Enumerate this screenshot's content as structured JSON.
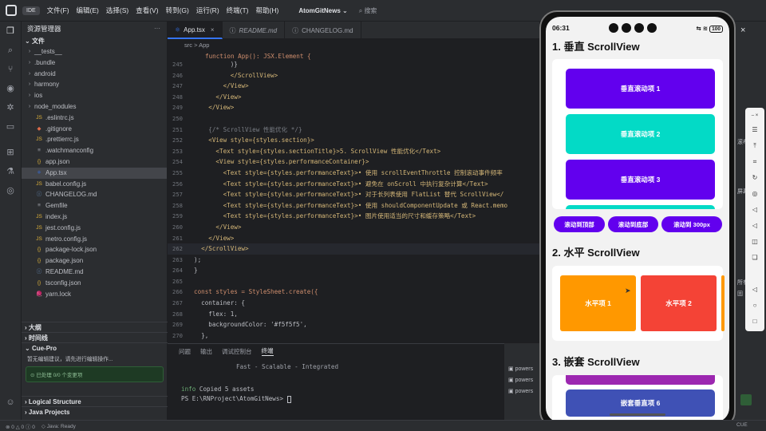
{
  "titlebar": {
    "logo_badge": "IDE",
    "menu": [
      "文件(F)",
      "编辑(E)",
      "选择(S)",
      "查看(V)",
      "转到(G)",
      "运行(R)",
      "终端(T)",
      "帮助(H)"
    ],
    "project": "AtomGitNews",
    "search_placeholder": "搜索"
  },
  "explorer": {
    "title": "资源管理器",
    "root": "文件",
    "items": [
      {
        "name": "__tests__",
        "type": "folder"
      },
      {
        "name": ".bundle",
        "type": "folder"
      },
      {
        "name": "android",
        "type": "folder"
      },
      {
        "name": "harmony",
        "type": "folder"
      },
      {
        "name": "ios",
        "type": "folder"
      },
      {
        "name": "node_modules",
        "type": "folder"
      },
      {
        "name": ".eslintrc.js",
        "type": "file"
      },
      {
        "name": ".gitignore",
        "type": "file"
      },
      {
        "name": ".prettierrc.js",
        "type": "file"
      },
      {
        "name": ".watchmanconfig",
        "type": "file"
      },
      {
        "name": "app.json",
        "type": "file"
      },
      {
        "name": "App.tsx",
        "type": "file"
      },
      {
        "name": "babel.config.js",
        "type": "file"
      },
      {
        "name": "CHANGELOG.md",
        "type": "file"
      },
      {
        "name": "Gemfile",
        "type": "file"
      },
      {
        "name": "index.js",
        "type": "file"
      },
      {
        "name": "jest.config.js",
        "type": "file"
      },
      {
        "name": "metro.config.js",
        "type": "file"
      },
      {
        "name": "package-lock.json",
        "type": "file"
      },
      {
        "name": "package.json",
        "type": "file"
      },
      {
        "name": "README.md",
        "type": "file"
      },
      {
        "name": "tsconfig.json",
        "type": "file"
      },
      {
        "name": "yarn.lock",
        "type": "file"
      }
    ],
    "outline": "大纲",
    "timeline": "时间线",
    "cue_title": "Cue-Pro",
    "cue_text": "暂无编辑建议，请先进行编辑操作...",
    "cue_status": "已处理 0/0 个变更项",
    "logical_structure": "Logical Structure",
    "java_projects": "Java Projects"
  },
  "editor": {
    "tabs": [
      "App.tsx",
      "README.md",
      "CHANGELOG.md"
    ],
    "breadcrumb": "src  >  App",
    "first_line": "function App(): JSX.Element {",
    "lines": [
      {
        "n": "245",
        "t": "          )}"
      },
      {
        "n": "246",
        "t": "          </ScrollView>"
      },
      {
        "n": "247",
        "t": "        </View>"
      },
      {
        "n": "248",
        "t": "      </View>"
      },
      {
        "n": "249",
        "t": "    </View>"
      },
      {
        "n": "250",
        "t": ""
      },
      {
        "n": "251",
        "t": "    {/* ScrollView 性能优化 */}"
      },
      {
        "n": "252",
        "t": "    <View style={styles.section}>"
      },
      {
        "n": "253",
        "t": "      <Text style={styles.sectionTitle}>5. ScrollView 性能优化</Text>"
      },
      {
        "n": "254",
        "t": "      <View style={styles.performanceContainer}>"
      },
      {
        "n": "255",
        "t": "        <Text style={styles.performanceText}>• 使用 scrollEventThrottle 控制滚动事件频率"
      },
      {
        "n": "256",
        "t": "        <Text style={styles.performanceText}>• 避免在 onScroll 中执行复杂计算</Text>"
      },
      {
        "n": "257",
        "t": "        <Text style={styles.performanceText}>• 对于长列表使用 FlatList 替代 ScrollView</"
      },
      {
        "n": "258",
        "t": "        <Text style={styles.performanceText}>• 使用 shouldComponentUpdate 或 React.memo"
      },
      {
        "n": "259",
        "t": "        <Text style={styles.performanceText}>• 图片使用适当的尺寸和缓存策略</Text>"
      },
      {
        "n": "260",
        "t": "      </View>"
      },
      {
        "n": "261",
        "t": "    </View>"
      },
      {
        "n": "262",
        "t": "  </ScrollView>"
      },
      {
        "n": "263",
        "t": ");"
      },
      {
        "n": "264",
        "t": "}"
      },
      {
        "n": "265",
        "t": ""
      },
      {
        "n": "266",
        "t": "const styles = StyleSheet.create({"
      },
      {
        "n": "267",
        "t": "  container: {"
      },
      {
        "n": "268",
        "t": "    flex: 1,"
      },
      {
        "n": "269",
        "t": "    backgroundColor: '#f5f5f5',"
      },
      {
        "n": "270",
        "t": "  },"
      }
    ]
  },
  "panel": {
    "tabs": [
      "问题",
      "输出",
      "调试控制台",
      "终端"
    ],
    "line1": "Fast - Scalable - Integrated",
    "line2_prefix": "info",
    "line2": " Copied 5 assets",
    "prompt": "PS E:\\RNProject\\AtomGitNews> ",
    "side_items": [
      "powers",
      "powers",
      "powers"
    ]
  },
  "status": {
    "errors": "0",
    "warnings": "0",
    "info": "0",
    "java": "Java: Ready",
    "right": "CUE"
  },
  "phone": {
    "time": "06:31",
    "battery": "100",
    "section1": "1. 垂直 ScrollView",
    "vitems": [
      "垂直滚动项 1",
      "垂直滚动项 2",
      "垂直滚动项 3"
    ],
    "buttons": [
      "滚动到顶部",
      "滚动到底部",
      "滚动到 300px"
    ],
    "section2": "2. 水平 ScrollView",
    "hitems": [
      "水平项 1",
      "水平项 2"
    ],
    "section3": "3. 嵌套 ScrollView",
    "nested_item": "嵌套垂直项 6",
    "colors": {
      "purple": "#6200ee",
      "teal": "#03dac6",
      "orange": "#ff9800",
      "red": "#f44336",
      "indigo": "#3f51b5",
      "magenta": "#9c27b0"
    }
  },
  "right_text": [
    "滚布",
    "屏幕",
    "所有",
    "固"
  ]
}
